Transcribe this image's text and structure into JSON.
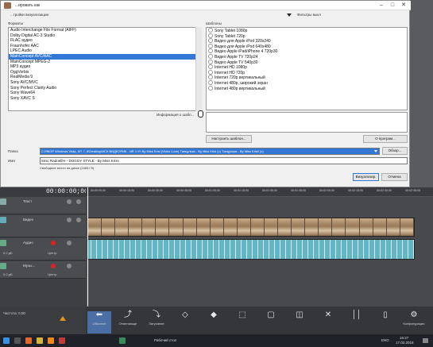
{
  "dialog": {
    "title": "...ировать как",
    "visualization_settings": "...тройки визуализации",
    "formats_label": "Форматы",
    "templates_label": "Шаблоны",
    "filters_label": "Фильтры выкл",
    "formats": [
      "Audio Interchange File Format (AIFF)",
      "Dolby Digital AC-3 Studio",
      "FLAC аудио",
      "Fraunhofer AAC",
      "LPEC Audio",
      "MainConcept AVC/AAC",
      "MainConcept MPEG-2",
      "MP3 аудио",
      "OggVorbis",
      "RealMedia 9",
      "Sony AVC/MVC",
      "Sony Perfect Clarity Audio",
      "Sony Wave64",
      "Sony XAVC S"
    ],
    "selected_format": "MainConcept AVC/AAC",
    "templates": [
      "Sony Tablet 1080p",
      "Sony Tablet 720p",
      "Видео для Apple iPod 320x240",
      "Видео для Apple iPod 640x480",
      "Видео Apple iPad/iPhone 4 720p30",
      "Видео Apple TV 720p24",
      "Видео Apple TV 540p30",
      "Internet HD 1080p",
      "Internet HD 720p",
      "Internet 720p вертикальный",
      "Internet 480p, широкий экран",
      "Internet 480p вертикальный"
    ],
    "info_label": "Информация о шабл...",
    "customize_button": "Настроить шаблон...",
    "about_button": "О програм...",
    "folder_label": "Папка",
    "folder_value": "C:\\ЯКОР Windows Vista, XP, 7, 8\\Desktop\\ИСХ ВИДЕОРИК - NR 1 !!!\\ By Miss Krisi (Video Love) Танцульки - By Miss Krisi (с) Танцульки - By Miss Krisi\\ (с)",
    "browse_button": "Обзор...",
    "name_label": "Имя",
    "name_value": "Sinic Radoelfre - DOGGY STYLE - By Miss Kriss",
    "free_space": "Свободное место на диске (2465 Гб)",
    "render_button": "Визуализир.",
    "cancel_button": "Отмена"
  },
  "timeline": {
    "timecode": "00:00:00;00",
    "ruler_ticks": [
      "00:00:00;00",
      "00:00:15;00",
      "00:00:30;00",
      "00:00:45;00",
      "00:01:00;00",
      "00:01:15;00",
      "00:01:30;00",
      "00:01:45;00",
      "00:02:00;00",
      "00:02:15;00",
      "00:02:30;00",
      "00:02:45;00"
    ],
    "tracks": [
      {
        "name": "Текст",
        "level": ""
      },
      {
        "name": "Видео",
        "level": ""
      },
      {
        "name": "Аудио",
        "level": "0,0 дБ",
        "pan": "Центр"
      },
      {
        "name": "Музы...",
        "level": "0,0 дБ",
        "pan": "Центр"
      }
    ],
    "rate": "Частота: 0,00"
  },
  "toolbar": {
    "tools": [
      "Обычное",
      "Отменяюще",
      "Затухание",
      "",
      "",
      "",
      "",
      "",
      "",
      "",
      "",
      "Конфигурации"
    ]
  },
  "taskbar": {
    "desktop_label": "Рабочий стол",
    "language": "ENG",
    "time": "16:27",
    "date": "17.02.2018"
  }
}
